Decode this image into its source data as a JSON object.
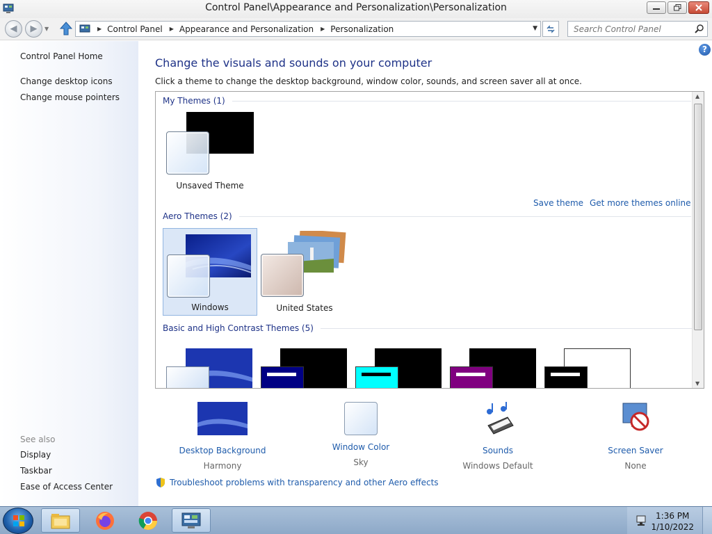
{
  "window": {
    "title": "Control Panel\\Appearance and Personalization\\Personalization"
  },
  "address": {
    "breadcrumbs": [
      "Control Panel",
      "Appearance and Personalization",
      "Personalization"
    ]
  },
  "search": {
    "placeholder": "Search Control Panel"
  },
  "sidebar": {
    "home": "Control Panel Home",
    "links": [
      "Change desktop icons",
      "Change mouse pointers"
    ],
    "see_also_label": "See also",
    "see_also": [
      "Display",
      "Taskbar",
      "Ease of Access Center"
    ]
  },
  "main": {
    "heading": "Change the visuals and sounds on your computer",
    "subtext": "Click a theme to change the desktop background, window color, sounds, and screen saver all at once.",
    "groups": {
      "my_themes": "My Themes (1)",
      "aero_themes": "Aero Themes (2)",
      "basic_themes": "Basic and High Contrast Themes (5)"
    },
    "my_themes": [
      {
        "name": "Unsaved Theme"
      }
    ],
    "aero_themes": [
      {
        "name": "Windows",
        "selected": true
      },
      {
        "name": "United States"
      }
    ],
    "basic_theme_colors": [
      "#000084",
      "#00ffff",
      "#800080",
      "#000000",
      "#ffffff"
    ],
    "save_theme": "Save theme",
    "get_more": "Get more themes online",
    "options": [
      {
        "title": "Desktop Background",
        "value": "Harmony"
      },
      {
        "title": "Window Color",
        "value": "Sky"
      },
      {
        "title": "Sounds",
        "value": "Windows Default"
      },
      {
        "title": "Screen Saver",
        "value": "None"
      }
    ],
    "troubleshoot": "Troubleshoot problems with transparency and other Aero effects"
  },
  "taskbar": {
    "pinned": [
      "file-explorer-icon",
      "firefox-icon",
      "chrome-icon",
      "control-panel-icon"
    ],
    "time": "1:36 PM",
    "date": "1/10/2022"
  },
  "colors": {
    "link": "#1e5bab",
    "heading": "#1e3287",
    "selected_bg": "#dbe7f7"
  }
}
